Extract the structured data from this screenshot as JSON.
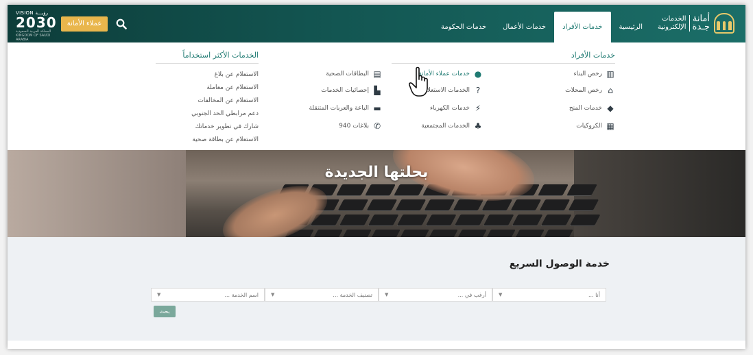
{
  "header": {
    "logo": {
      "line1": "أمانة",
      "line2": "جـدة",
      "line3": "الخدمات",
      "line4": "الإلكترونية"
    },
    "nav": [
      {
        "label": "الرئيسية",
        "active": false
      },
      {
        "label": "خدمات الأفراد",
        "active": true
      },
      {
        "label": "خدمات الأعمال",
        "active": false
      },
      {
        "label": "خدمات الحكومة",
        "active": false
      }
    ],
    "employees_button": "عملاء الأمانة",
    "vision": {
      "top": "VISION رؤيـــة",
      "number": "2030",
      "sub": "المملكة العربية السعودية KINGDOM OF SAUDI ARABIA"
    }
  },
  "menu": {
    "individuals_title": "خدمات الأفراد",
    "col1": [
      {
        "label": "رخص البناء",
        "icon": "building-icon"
      },
      {
        "label": "رخص المحلات",
        "icon": "shop-icon"
      },
      {
        "label": "خدمات المنح",
        "icon": "map-pin-icon"
      },
      {
        "label": "الكروكيات",
        "icon": "map-icon"
      }
    ],
    "col2": [
      {
        "label": "خدمات عملاء الأمانة",
        "icon": "user-icon",
        "highlight": true
      },
      {
        "label": "الخدمات الاستعلامية",
        "icon": "question-icon"
      },
      {
        "label": "خدمات الكهرباء",
        "icon": "electricity-icon"
      },
      {
        "label": "الخدمات المجتمعية",
        "icon": "plant-icon"
      }
    ],
    "col3": [
      {
        "label": "البطاقات الصحية",
        "icon": "id-card-icon"
      },
      {
        "label": "إحصائيات الخدمات",
        "icon": "chart-icon"
      },
      {
        "label": "الباعة والعربات المتنقلة",
        "icon": "cart-icon"
      },
      {
        "label": "بلاغات 940",
        "icon": "phone-icon"
      }
    ],
    "popular_title": "الخدمات الأكثر استخداماً",
    "popular": [
      "الاستعلام عن بلاغ",
      "الاستعلام عن معاملة",
      "الاستعلام عن المخالفات",
      "دعم مرابطي الحد الجنوبي",
      "شارك في تطوير خدماتك",
      "الاستعلام عن بطاقة صحية"
    ]
  },
  "hero": {
    "title": "بحلتها الجديدة"
  },
  "quick_access": {
    "title": "خدمة الوصول السريع",
    "selects": [
      {
        "placeholder": "أنا ..."
      },
      {
        "placeholder": "أرغب في ..."
      },
      {
        "placeholder": "تصنيف الخدمة ..."
      },
      {
        "placeholder": "اسم الخدمة ..."
      }
    ],
    "search_button": "بحث"
  }
}
